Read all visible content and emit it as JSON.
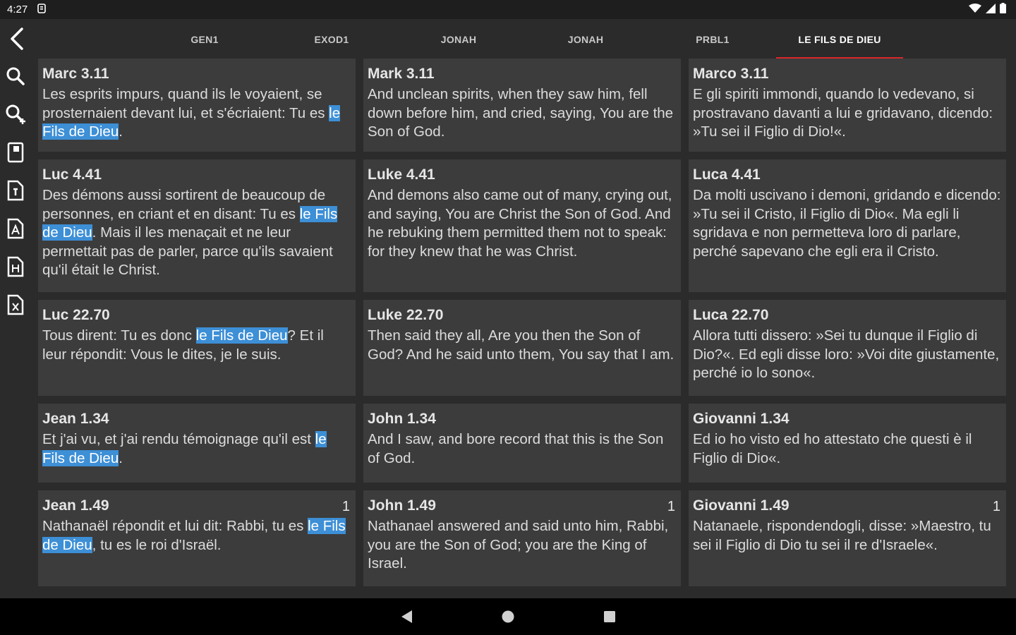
{
  "status": {
    "time": "4:27"
  },
  "tabs": [
    {
      "label": "GEN1"
    },
    {
      "label": "EXOD1"
    },
    {
      "label": "JONAH"
    },
    {
      "label": "JONAH"
    },
    {
      "label": "PRBL1"
    },
    {
      "label": "LE FILS DE DIEU",
      "active": true
    }
  ],
  "sidebar_icons": [
    "search-icon",
    "search-add-icon",
    "book-icon",
    "file-icon",
    "font-file-icon",
    "document-h-icon",
    "document-x-icon"
  ],
  "results": [
    {
      "fr": {
        "ref": "Marc 3.11",
        "pre": "Les esprits impurs, quand ils le voyaient, se prosternaient devant lui, et s'écriaient: Tu es ",
        "hl": "le Fils de Dieu",
        "post": "."
      },
      "en": {
        "ref": "Mark 3.11",
        "text": "And unclean spirits, when they saw him, fell down before him, and cried, saying, You are the Son of God."
      },
      "it": {
        "ref": "Marco 3.11",
        "text": "E gli spiriti immondi, quando lo vedevano, si prostravano davanti a lui e gridavano, dicendo: »Tu sei il Figlio di Dio!«."
      }
    },
    {
      "fr": {
        "ref": "Luc 4.41",
        "pre": "Des démons aussi sortirent de beaucoup de personnes, en criant et en disant: Tu es ",
        "hl": "le Fils de Dieu",
        "post": ". Mais il les menaçait et ne leur permettait pas de parler, parce qu'ils savaient qu'il était le Christ."
      },
      "en": {
        "ref": "Luke 4.41",
        "text": "And demons also came out of many, crying out, and saying, You are Christ the Son of God. And he rebuking them permitted them not to speak: for they knew that he was Christ."
      },
      "it": {
        "ref": "Luca 4.41",
        "text": "Da molti uscivano i demoni, gridando e dicendo: »Tu sei il Cristo, il Figlio di Dio«. Ma egli li sgridava e non permetteva loro di parlare, perché sapevano che egli era il Cristo."
      }
    },
    {
      "fr": {
        "ref": "Luc 22.70",
        "pre": "Tous dirent: Tu es donc ",
        "hl": "le Fils de Dieu",
        "post": "? Et il leur répondit: Vous le dites, je le suis."
      },
      "en": {
        "ref": "Luke 22.70",
        "text": "Then said they all, Are you then the Son of God? And he said unto them, You say that I am."
      },
      "it": {
        "ref": "Luca 22.70",
        "text": "Allora tutti dissero: »Sei tu dunque il Figlio di Dio?«. Ed egli disse loro: »Voi dite giustamente, perché io lo sono«."
      }
    },
    {
      "fr": {
        "ref": "Jean 1.34",
        "pre": "Et j'ai vu, et j'ai rendu témoignage qu'il est ",
        "hl": "le Fils de Dieu",
        "post": "."
      },
      "en": {
        "ref": "John 1.34",
        "text": "And I saw, and bore record that this is the Son of God."
      },
      "it": {
        "ref": "Giovanni 1.34",
        "text": "Ed io ho visto ed ho attestato che questi è il Figlio di Dio«."
      }
    },
    {
      "count": "1",
      "fr": {
        "ref": "Jean 1.49",
        "pre": "Nathanaël répondit et lui dit: Rabbi, tu es ",
        "hl": "le Fils de Dieu",
        "post": ", tu es le roi d'Israël."
      },
      "en": {
        "ref": "John 1.49",
        "text": "Nathanael answered and said unto him, Rabbi, you are the Son of God; you are the King of Israel."
      },
      "it": {
        "ref": "Giovanni 1.49",
        "text": "Natanaele, rispondendogli, disse: »Maestro, tu sei il Figlio di Dio tu sei il re d'Israele«."
      }
    }
  ],
  "colors": {
    "accent": "#d9262b",
    "highlight": "#3d8fd6",
    "card": "#3c3c3c",
    "background": "#2b2b2b"
  }
}
